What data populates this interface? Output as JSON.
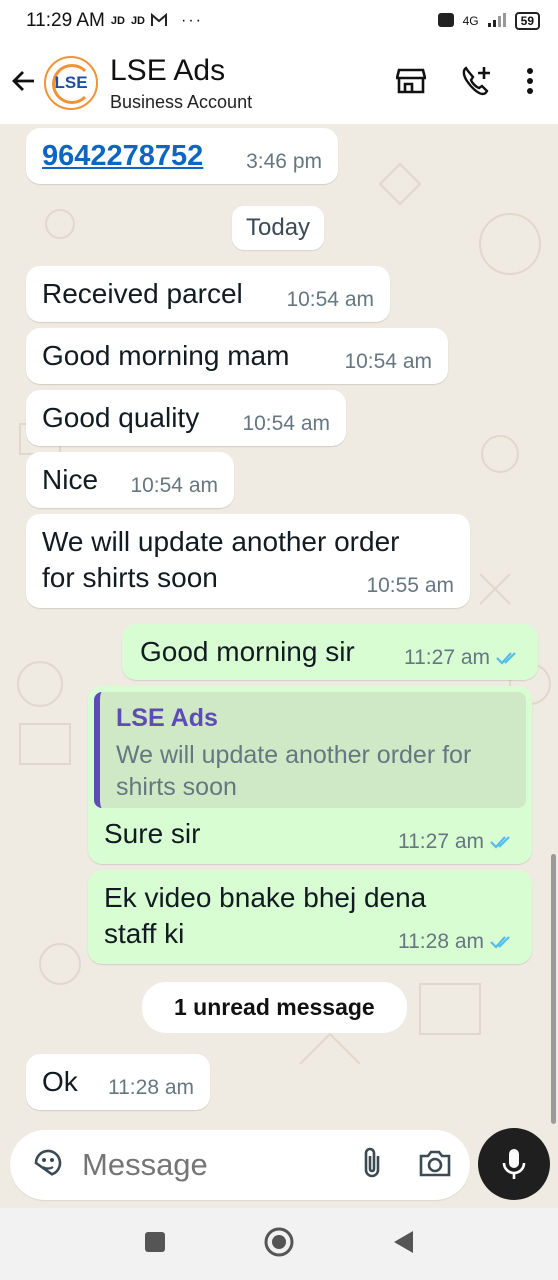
{
  "status_bar": {
    "time": "11:29 AM",
    "carrier_1": "JD",
    "carrier_2": "JD",
    "overflow": "···",
    "network": "4G",
    "battery": "59"
  },
  "header": {
    "back_icon": "arrow-left-icon",
    "avatar_text": "LSE",
    "title": "LSE Ads",
    "subtitle": "Business Account",
    "store_icon": "storefront-icon",
    "call_icon": "add-call-icon",
    "menu_icon": "more-vert-icon"
  },
  "chat": {
    "top_message": {
      "link": "9642278752",
      "time": "3:46 pm"
    },
    "date_label": "Today",
    "incoming": [
      {
        "text": "Received parcel",
        "time": "10:54 am"
      },
      {
        "text": "Good morning mam",
        "time": "10:54 am"
      },
      {
        "text": "Good quality",
        "time": "10:54 am"
      },
      {
        "text": "Nice",
        "time": "10:54 am"
      },
      {
        "text_line1": "We will update another order",
        "text_line2": "for shirts soon",
        "time": "10:55 am"
      }
    ],
    "outgoing": [
      {
        "text": "Good morning sir",
        "time": "11:27 am",
        "status_icon": "double-check-icon"
      },
      {
        "quote_author": "LSE Ads",
        "quote_line1": "We will update another order for",
        "quote_line2": "shirts soon",
        "text": "Sure sir",
        "time": "11:27 am",
        "status_icon": "double-check-icon"
      },
      {
        "text_line1": "Ek video bnake bhej dena",
        "text_line2": "staff ki",
        "time": "11:28 am",
        "status_icon": "double-check-icon"
      }
    ],
    "unread_label": "1 unread message",
    "last_message": {
      "text": "Ok",
      "time": "11:28 am"
    }
  },
  "composer": {
    "placeholder": "Message",
    "emoji_icon": "sticker-icon",
    "attach_icon": "paperclip-icon",
    "camera_icon": "camera-icon",
    "mic_icon": "mic-icon"
  },
  "colors": {
    "background": "#efeae2",
    "outgoing_bubble": "#d9fdd3",
    "incoming_bubble": "#ffffff",
    "link": "#0c66c2",
    "read_tick": "#53bdeb",
    "quote_accent": "#5e4bb6"
  }
}
